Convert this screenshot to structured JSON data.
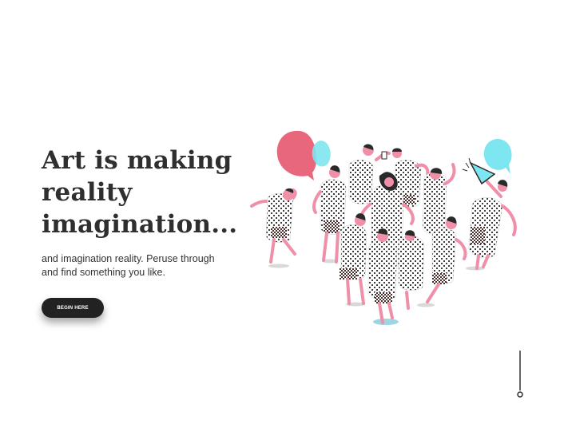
{
  "hero": {
    "title": "Art is making reality imagination...",
    "subtitle": "and imagination reality. Peruse through and find something you like.",
    "cta_label": "BEGIN HERE"
  },
  "colors": {
    "text": "#2f2f2f",
    "button_bg": "#222222",
    "accent_pink": "#e8677d",
    "accent_cyan": "#7ee6f0",
    "skin": "#ef8fa8",
    "dots": "#2a2a2a"
  },
  "illustration": {
    "icon": "dancing-crowd-illustration"
  },
  "scroll": {
    "icon": "scroll-down-indicator-icon"
  }
}
